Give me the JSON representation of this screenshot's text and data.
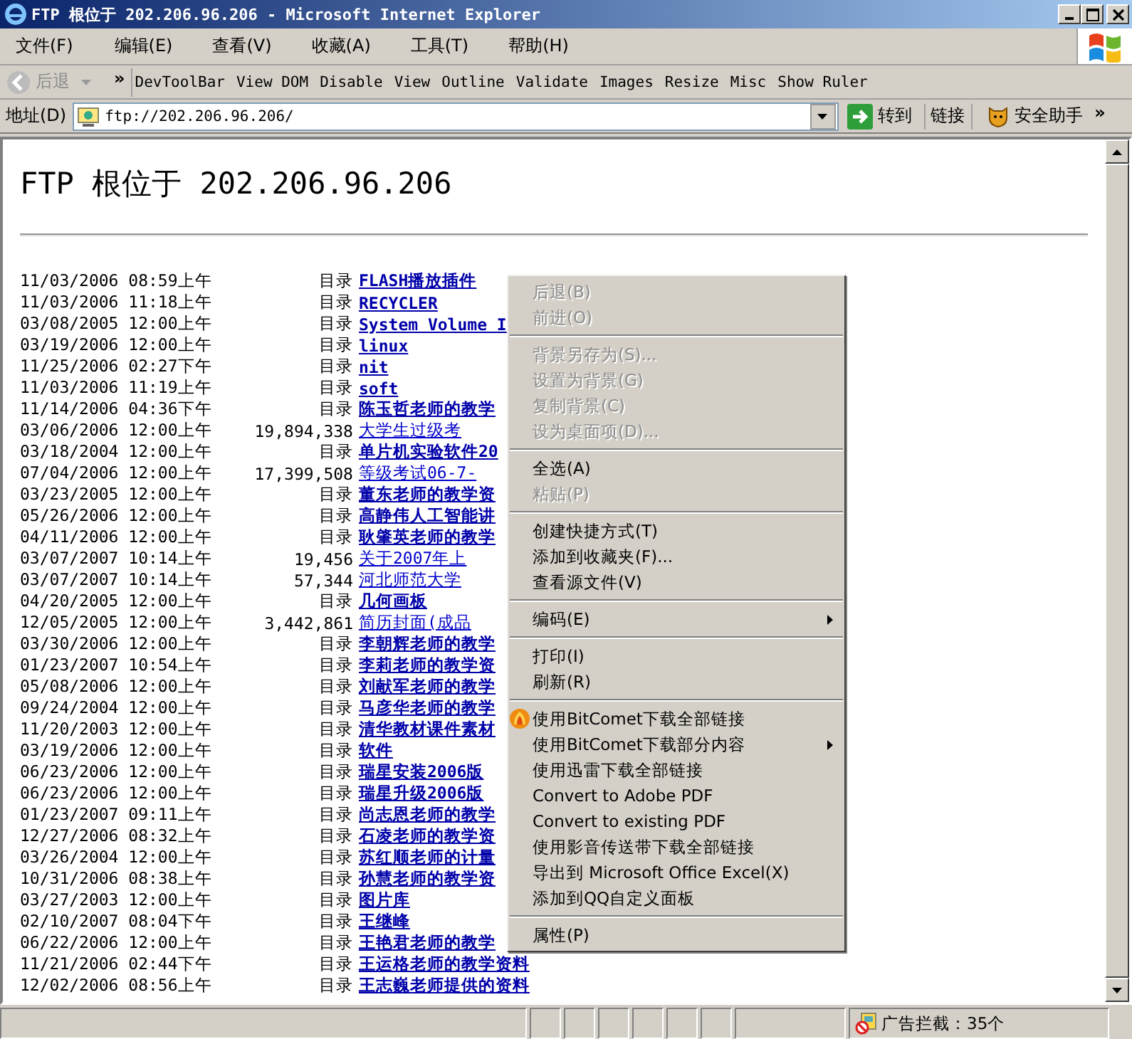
{
  "window": {
    "title": "FTP 根位于 202.206.96.206 - Microsoft Internet Explorer"
  },
  "menu_bar": [
    "文件(F)",
    "编辑(E)",
    "查看(V)",
    "收藏(A)",
    "工具(T)",
    "帮助(H)"
  ],
  "toolbar": {
    "back": "后退",
    "chevron": "»",
    "links": [
      "DevToolBar",
      "View DOM",
      "Disable",
      "View",
      "Outline",
      "Validate",
      "Images",
      "Resize",
      "Misc",
      "Show Ruler"
    ]
  },
  "address_bar": {
    "label": "地址(D)",
    "value": "ftp://202.206.96.206/",
    "go": "转到",
    "links": "链接",
    "helper": "安全助手",
    "chevron": "»"
  },
  "heading": "FTP 根位于 202.206.96.206",
  "listing": [
    {
      "date": "11/03/2006 08:59上午",
      "kind": "dir",
      "size": "目录",
      "name": "FLASH播放插件"
    },
    {
      "date": "11/03/2006 11:18上午",
      "kind": "dir",
      "size": "目录",
      "name": "RECYCLER"
    },
    {
      "date": "03/08/2005 12:00上午",
      "kind": "dir",
      "size": "目录",
      "name": "System Volume I"
    },
    {
      "date": "03/19/2006 12:00上午",
      "kind": "dir",
      "size": "目录",
      "name": "linux"
    },
    {
      "date": "11/25/2006 02:27下午",
      "kind": "dir",
      "size": "目录",
      "name": "nit"
    },
    {
      "date": "11/03/2006 11:19上午",
      "kind": "dir",
      "size": "目录",
      "name": "soft"
    },
    {
      "date": "11/14/2006 04:36下午",
      "kind": "dir",
      "size": "目录",
      "name": "陈玉哲老师的教学"
    },
    {
      "date": "03/06/2006 12:00上午",
      "kind": "file",
      "size": "19,894,338",
      "name": "大学生过级考"
    },
    {
      "date": "03/18/2004 12:00上午",
      "kind": "dir",
      "size": "目录",
      "name": "单片机实验软件20"
    },
    {
      "date": "07/04/2006 12:00上午",
      "kind": "file",
      "size": "17,399,508",
      "name": "等级考试06-7-"
    },
    {
      "date": "03/23/2005 12:00上午",
      "kind": "dir",
      "size": "目录",
      "name": "董东老师的教学资"
    },
    {
      "date": "05/26/2006 12:00上午",
      "kind": "dir",
      "size": "目录",
      "name": "高静伟人工智能讲"
    },
    {
      "date": "04/11/2006 12:00上午",
      "kind": "dir",
      "size": "目录",
      "name": "耿肇英老师的教学"
    },
    {
      "date": "03/07/2007 10:14上午",
      "kind": "file",
      "size": "19,456",
      "name": "关于2007年上"
    },
    {
      "date": "03/07/2007 10:14上午",
      "kind": "file",
      "size": "57,344",
      "name": "河北师范大学"
    },
    {
      "date": "04/20/2005 12:00上午",
      "kind": "dir",
      "size": "目录",
      "name": "几何画板"
    },
    {
      "date": "12/05/2005 12:00上午",
      "kind": "file",
      "size": "3,442,861",
      "name": "简历封面(成品"
    },
    {
      "date": "03/30/2006 12:00上午",
      "kind": "dir",
      "size": "目录",
      "name": "李朝辉老师的教学"
    },
    {
      "date": "01/23/2007 10:54上午",
      "kind": "dir",
      "size": "目录",
      "name": "李莉老师的教学资"
    },
    {
      "date": "05/08/2006 12:00上午",
      "kind": "dir",
      "size": "目录",
      "name": "刘献军老师的教学"
    },
    {
      "date": "09/24/2004 12:00上午",
      "kind": "dir",
      "size": "目录",
      "name": "马彦华老师的教学"
    },
    {
      "date": "11/20/2003 12:00上午",
      "kind": "dir",
      "size": "目录",
      "name": "清华教材课件素材"
    },
    {
      "date": "03/19/2006 12:00上午",
      "kind": "dir",
      "size": "目录",
      "name": "软件"
    },
    {
      "date": "06/23/2006 12:00上午",
      "kind": "dir",
      "size": "目录",
      "name": "瑞星安装2006版"
    },
    {
      "date": "06/23/2006 12:00上午",
      "kind": "dir",
      "size": "目录",
      "name": "瑞星升级2006版"
    },
    {
      "date": "01/23/2007 09:11上午",
      "kind": "dir",
      "size": "目录",
      "name": "尚志恩老师的教学"
    },
    {
      "date": "12/27/2006 08:32上午",
      "kind": "dir",
      "size": "目录",
      "name": "石凌老师的教学资"
    },
    {
      "date": "03/26/2004 12:00上午",
      "kind": "dir",
      "size": "目录",
      "name": "苏红顺老师的计量"
    },
    {
      "date": "10/31/2006 08:38上午",
      "kind": "dir",
      "size": "目录",
      "name": "孙慧老师的教学资"
    },
    {
      "date": "03/27/2003 12:00上午",
      "kind": "dir",
      "size": "目录",
      "name": "图片库"
    },
    {
      "date": "02/10/2007 08:04下午",
      "kind": "dir",
      "size": "目录",
      "name": "王继峰"
    },
    {
      "date": "06/22/2006 12:00上午",
      "kind": "dir",
      "size": "目录",
      "name": "王艳君老师的教学"
    },
    {
      "date": "11/21/2006 02:44下午",
      "kind": "dir",
      "size": "目录",
      "name": "王运格老师的教学资料"
    },
    {
      "date": "12/02/2006 08:56上午",
      "kind": "dir",
      "size": "目录",
      "name": "王志巍老师提供的资料"
    }
  ],
  "context_menu": [
    {
      "kind": "item",
      "label": "后退(B)",
      "disabled": true
    },
    {
      "kind": "item",
      "label": "前进(O)",
      "disabled": true
    },
    {
      "kind": "separator"
    },
    {
      "kind": "item",
      "label": "背景另存为(S)...",
      "disabled": true
    },
    {
      "kind": "item",
      "label": "设置为背景(G)",
      "disabled": true
    },
    {
      "kind": "item",
      "label": "复制背景(C)",
      "disabled": true
    },
    {
      "kind": "item",
      "label": "设为桌面项(D)...",
      "disabled": true
    },
    {
      "kind": "separator"
    },
    {
      "kind": "item",
      "label": "全选(A)",
      "disabled": false
    },
    {
      "kind": "item",
      "label": "粘贴(P)",
      "disabled": true
    },
    {
      "kind": "separator"
    },
    {
      "kind": "item",
      "label": "创建快捷方式(T)",
      "disabled": false
    },
    {
      "kind": "item",
      "label": "添加到收藏夹(F)...",
      "disabled": false
    },
    {
      "kind": "item",
      "label": "查看源文件(V)",
      "disabled": false
    },
    {
      "kind": "separator"
    },
    {
      "kind": "submenu",
      "label": "编码(E)",
      "disabled": false
    },
    {
      "kind": "separator"
    },
    {
      "kind": "item",
      "label": "打印(I)",
      "disabled": false
    },
    {
      "kind": "item",
      "label": "刷新(R)",
      "disabled": false
    },
    {
      "kind": "separator"
    },
    {
      "kind": "icon-item",
      "label": "使用BitComet下载全部链接",
      "disabled": false
    },
    {
      "kind": "submenu",
      "label": "使用BitComet下载部分内容",
      "disabled": false
    },
    {
      "kind": "item",
      "label": "使用迅雷下载全部链接",
      "disabled": false
    },
    {
      "kind": "item",
      "label": "Convert to Adobe PDF",
      "disabled": false
    },
    {
      "kind": "item",
      "label": "Convert to existing PDF",
      "disabled": false
    },
    {
      "kind": "item",
      "label": "使用影音传送带下载全部链接",
      "disabled": false
    },
    {
      "kind": "item",
      "label": "导出到 Microsoft Office Excel(X)",
      "disabled": false
    },
    {
      "kind": "item",
      "label": "添加到QQ自定义面板",
      "disabled": false
    },
    {
      "kind": "separator"
    },
    {
      "kind": "item",
      "label": "属性(P)",
      "disabled": false
    }
  ],
  "status_bar": {
    "blocked_ads": "广告拦截：35个"
  }
}
